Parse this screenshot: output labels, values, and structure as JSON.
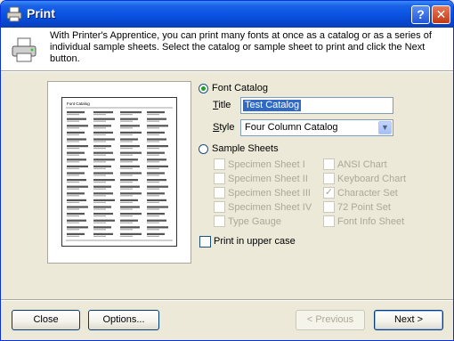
{
  "window": {
    "title": "Print"
  },
  "header": {
    "description": "With Printer's Apprentice, you can print many fonts at once as a catalog or as a series of individual sample sheets. Select the catalog or sample sheet to print and click the Next button."
  },
  "font_catalog": {
    "label": "Font Catalog",
    "selected": true,
    "title_label": "Title",
    "title_value": "Test Catalog",
    "style_label": "Style",
    "style_value": "Four Column Catalog"
  },
  "sample_sheets": {
    "label": "Sample Sheets",
    "selected": false,
    "options": [
      {
        "label": "Specimen Sheet I",
        "checked": false
      },
      {
        "label": "Specimen Sheet II",
        "checked": false
      },
      {
        "label": "Specimen Sheet III",
        "checked": false
      },
      {
        "label": "Specimen Sheet IV",
        "checked": false
      },
      {
        "label": "Type Gauge",
        "checked": false
      },
      {
        "label": "ANSI Chart",
        "checked": false
      },
      {
        "label": "Keyboard Chart",
        "checked": false
      },
      {
        "label": "Character Set",
        "checked": true
      },
      {
        "label": "72 Point Set",
        "checked": false
      },
      {
        "label": "Font Info Sheet",
        "checked": false
      }
    ]
  },
  "upper_case": {
    "label": "Print in upper case",
    "checked": false
  },
  "preview": {
    "page_title": "Font Catalog"
  },
  "buttons": {
    "close": "Close",
    "options": "Options...",
    "previous": "< Previous",
    "next": "Next >"
  }
}
